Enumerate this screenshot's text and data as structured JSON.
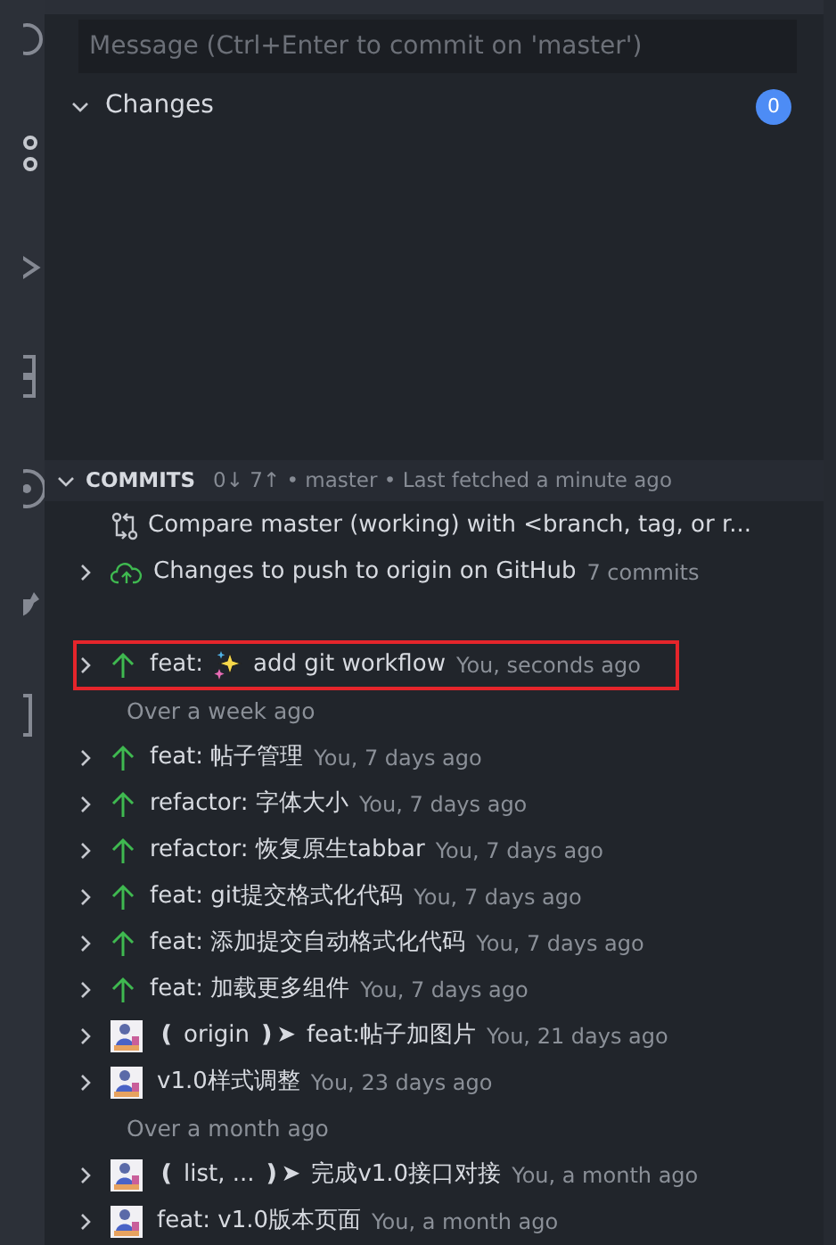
{
  "commit_box": {
    "placeholder": "Message (Ctrl+Enter to commit on 'master')"
  },
  "changes": {
    "label": "Changes",
    "count": "0",
    "expanded": true
  },
  "commits": {
    "title": "COMMITS",
    "summary": "0↓ 7↑ • master • Last fetched a minute ago",
    "expanded": true,
    "items": [
      {
        "kind": "compare",
        "label": "Compare master (working) with <branch, tag, or r..."
      },
      {
        "kind": "push",
        "label": "Changes to push to origin on GitHub",
        "detail": "7 commits",
        "expanded": false
      },
      {
        "kind": "spacer"
      },
      {
        "kind": "emoji-commit",
        "message": "feat:",
        "message_rest": "add git workflow",
        "meta": "You, seconds ago",
        "highlighted": true,
        "expanded": false
      },
      {
        "kind": "group",
        "label": "Over a week ago"
      },
      {
        "kind": "local-commit",
        "message": "feat: 帖子管理",
        "meta": "You, 7 days ago",
        "highlighted": false,
        "expanded": false
      },
      {
        "kind": "local-commit",
        "message": "refactor: 字体大小",
        "meta": "You, 7 days ago",
        "highlighted": false,
        "expanded": false
      },
      {
        "kind": "local-commit",
        "message": "refactor: 恢复原生tabbar",
        "meta": "You, 7 days ago",
        "highlighted": false,
        "expanded": false
      },
      {
        "kind": "local-commit",
        "message": "feat: git提交格式化代码",
        "meta": "You, 7 days ago",
        "highlighted": false,
        "expanded": false
      },
      {
        "kind": "local-commit",
        "message": "feat: 添加提交自动格式化代码",
        "meta": "You, 7 days ago",
        "highlighted": false,
        "expanded": false
      },
      {
        "kind": "local-commit",
        "message": "feat: 加载更多组件",
        "meta": "You, 7 days ago",
        "highlighted": false,
        "expanded": false
      },
      {
        "kind": "author-commit",
        "refs": "❪ origin ❫➤",
        "message": "feat:帖子加图片",
        "meta": "You, 21 days ago",
        "highlighted": false,
        "expanded": false
      },
      {
        "kind": "author-commit",
        "message": "v1.0样式调整",
        "meta": "You, 23 days ago",
        "highlighted": false,
        "expanded": false
      },
      {
        "kind": "group",
        "label": "Over a month ago"
      },
      {
        "kind": "author-commit",
        "refs": "❪ list, ... ❫➤",
        "message": "完成v1.0接口对接",
        "meta": "You, a month ago",
        "highlighted": false,
        "expanded": false
      },
      {
        "kind": "author-commit",
        "message": "feat: v1.0版本页面",
        "meta": "You, a month ago",
        "highlighted": false,
        "expanded": false
      }
    ]
  }
}
